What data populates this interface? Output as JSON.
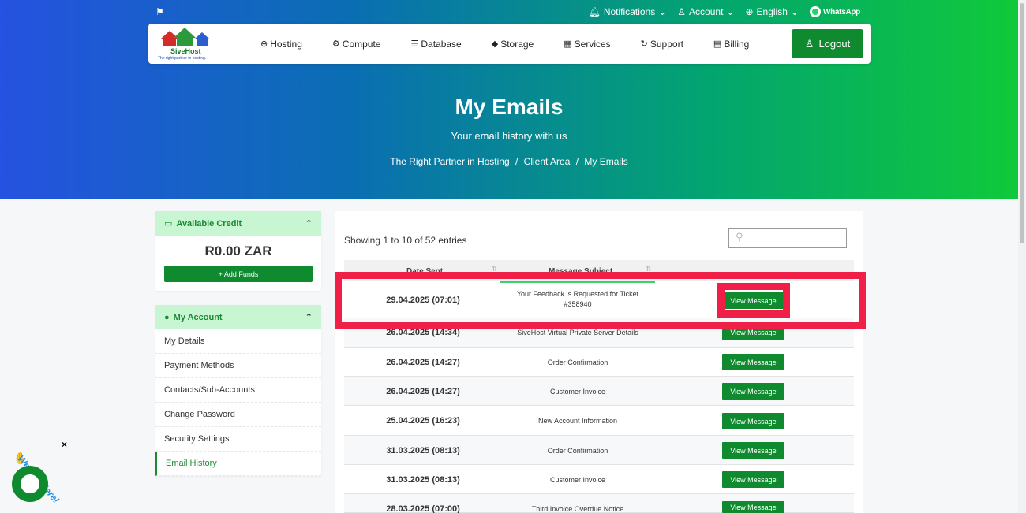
{
  "topbar": {
    "notifications": "Notifications",
    "account": "Account",
    "language": "English",
    "whatsapp": "WhatsApp"
  },
  "logo": {
    "brand": "SiveHost",
    "tagline": "The right partner in hosting."
  },
  "nav": {
    "items": [
      {
        "label": "Hosting",
        "icon": "⊕"
      },
      {
        "label": "Compute",
        "icon": "⚙"
      },
      {
        "label": "Database",
        "icon": "☰"
      },
      {
        "label": "Storage",
        "icon": "◆"
      },
      {
        "label": "Services",
        "icon": "▦"
      },
      {
        "label": "Support",
        "icon": "↻"
      },
      {
        "label": "Billing",
        "icon": "▤"
      }
    ],
    "logout": "Logout"
  },
  "hero": {
    "title": "My Emails",
    "subtitle": "Your email history with us",
    "breadcrumb": [
      "The Right Partner in Hosting",
      "Client Area",
      "My Emails"
    ]
  },
  "sidebar": {
    "credit_title": "Available Credit",
    "credit_value": "R0.00 ZAR",
    "add_funds": "+ Add Funds",
    "account_title": "My Account",
    "account_items": [
      "My Details",
      "Payment Methods",
      "Contacts/Sub-Accounts",
      "Change Password",
      "Security Settings",
      "Email History"
    ]
  },
  "table": {
    "entries_text": "Showing 1 to 10 of 52 entries",
    "columns": [
      "Date Sent",
      "Message Subject"
    ],
    "view_label": "View Message",
    "rows": [
      {
        "date": "29.04.2025 (07:01)",
        "subject_line1": "Your Feedback is Requested for Ticket",
        "subject_line2": "#358940"
      },
      {
        "date": "26.04.2025 (14:34)",
        "subject_line1": "SiveHost Virtual Private Server Details",
        "subject_line2": ""
      },
      {
        "date": "26.04.2025 (14:27)",
        "subject_line1": "Order Confirmation",
        "subject_line2": ""
      },
      {
        "date": "26.04.2025 (14:27)",
        "subject_line1": "Customer Invoice",
        "subject_line2": ""
      },
      {
        "date": "25.04.2025 (16:23)",
        "subject_line1": "New Account Information",
        "subject_line2": ""
      },
      {
        "date": "31.03.2025 (08:13)",
        "subject_line1": "Order Confirmation",
        "subject_line2": ""
      },
      {
        "date": "31.03.2025 (08:13)",
        "subject_line1": "Customer Invoice",
        "subject_line2": ""
      },
      {
        "date": "28.03.2025 (07:00)",
        "subject_line1": "Third Invoice Overdue Notice",
        "subject_line2": ""
      }
    ]
  },
  "chat": {
    "text": "We Are Here!",
    "close": "×"
  },
  "colors": {
    "accent_green": "#0f8a2e",
    "highlight_red": "#f01f48",
    "panel_header": "#c8f5d2"
  }
}
